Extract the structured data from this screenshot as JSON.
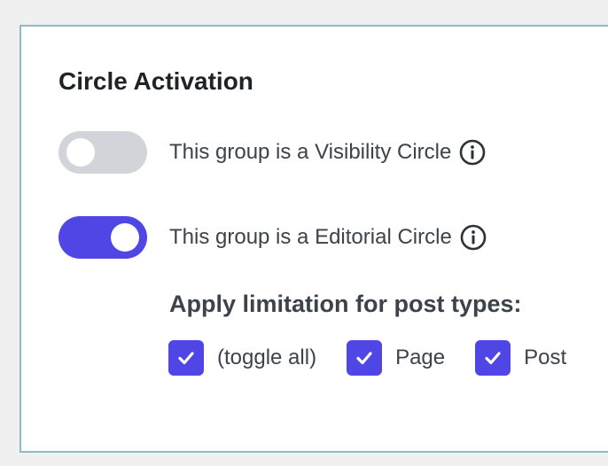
{
  "section": {
    "title": "Circle Activation"
  },
  "toggles": [
    {
      "label": "This group is a Visibility Circle",
      "checked": false
    },
    {
      "label": "This group is a Editorial Circle",
      "checked": true
    }
  ],
  "limitation": {
    "heading": "Apply limitation for post types:",
    "options": [
      {
        "label": "(toggle all)",
        "checked": true
      },
      {
        "label": "Page",
        "checked": true
      },
      {
        "label": "Post",
        "checked": true
      }
    ]
  },
  "colors": {
    "accent": "#4f46e5",
    "toggle_off": "#d1d4d8",
    "panel_border": "#8fbcc4",
    "background": "#f0f0f1"
  },
  "icons": {
    "info": "info-circle-icon",
    "check": "checkmark-icon"
  }
}
